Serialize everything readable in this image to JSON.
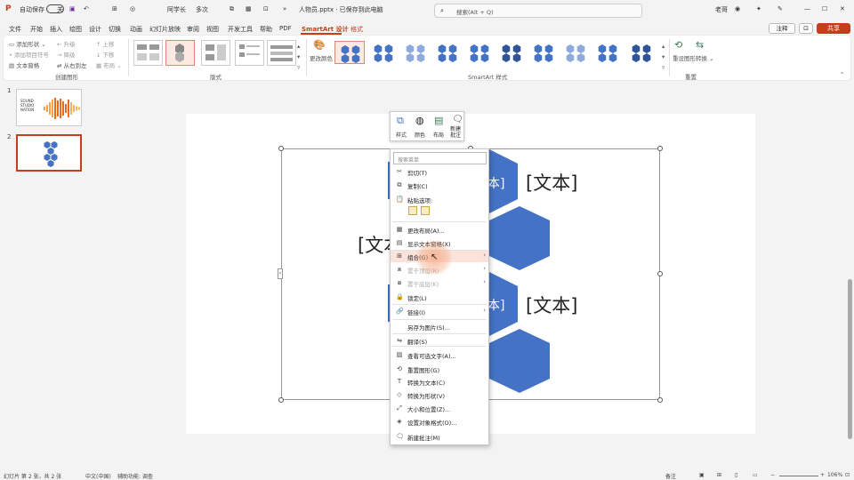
{
  "titlebar": {
    "autosave_label": "自动保存",
    "toggle_state": "关",
    "present_label": "阿学长",
    "draw_label": "多次",
    "filename": "人物员.pptx · 已保存到此电脑",
    "search_placeholder": "搜索(Alt + Q)",
    "user": "老哥"
  },
  "menu": {
    "tabs": [
      "文件",
      "开始",
      "插入",
      "绘图",
      "设计",
      "切换",
      "动画",
      "幻灯片放映",
      "审阅",
      "视图",
      "开发工具",
      "帮助",
      "PDF"
    ],
    "active_tab": "SmartArt 设计",
    "extra_tab": "格式",
    "comment_label": "注释",
    "share_label": "共享"
  },
  "ribbon": {
    "create": {
      "add_shape": "添加形状",
      "add_bullet": "添加项目符号",
      "text_pane": "文本窗格",
      "promote": "升级",
      "demote": "降级",
      "right_to_left": "从右到左",
      "move_up": "上移",
      "move_down": "下移",
      "layout": "布局",
      "group_label": "创建图形"
    },
    "layouts_group_label": "版式",
    "change_colors": "更改颜色",
    "styles_group_label": "SmartArt 样式",
    "reset_graphic": "重设图形",
    "convert": "转换",
    "reset_group_label": "重置"
  },
  "slides": [
    {
      "number": "1",
      "logo_text": "SOUND\nSTUDIO\nNATION"
    },
    {
      "number": "2"
    }
  ],
  "canvas": {
    "text_right_top": "[文本]",
    "text_right_bottom": "[文本]",
    "text_left": "[文本",
    "text_partial_top": "本]",
    "text_partial_bottom": "本]"
  },
  "mini_toolbar": {
    "style": "样式",
    "color": "颜色",
    "layout": "布局",
    "new_comment": "新建批注"
  },
  "context_menu": {
    "search_placeholder": "搜索菜单",
    "items": [
      {
        "label": "剪切(T)",
        "icon": "cut-icon",
        "disabled": false
      },
      {
        "label": "复制(C)",
        "icon": "copy-icon",
        "disabled": false
      },
      {
        "label": "粘贴选项:",
        "icon": "paste-icon",
        "disabled": false
      },
      {
        "label": "更改布局(A)...",
        "icon": "layout-icon",
        "disabled": false
      },
      {
        "label": "显示文本窗格(X)",
        "icon": "text-pane-icon",
        "disabled": false
      },
      {
        "label": "组合(G)",
        "icon": "group-icon",
        "disabled": false,
        "submenu": true,
        "hover": true
      },
      {
        "label": "置于顶层(R)",
        "icon": "bring-front-icon",
        "disabled": true,
        "submenu": true
      },
      {
        "label": "置于底层(K)",
        "icon": "send-back-icon",
        "disabled": true,
        "submenu": true
      },
      {
        "label": "锁定(L)",
        "icon": "lock-icon",
        "disabled": false
      },
      {
        "label": "链接(I)",
        "icon": "link-icon",
        "disabled": false,
        "submenu": true
      },
      {
        "label": "另存为图片(S)...",
        "icon": "",
        "disabled": false
      },
      {
        "label": "翻译(S)",
        "icon": "translate-icon",
        "disabled": false
      },
      {
        "label": "查看可选文字(A)...",
        "icon": "alt-text-icon",
        "disabled": false
      },
      {
        "label": "重置图形(G)",
        "icon": "reset-icon",
        "disabled": false
      },
      {
        "label": "转换为文本(C)",
        "icon": "convert-text-icon",
        "disabled": false
      },
      {
        "label": "转换为形状(V)",
        "icon": "convert-shape-icon",
        "disabled": false
      },
      {
        "label": "大小和位置(Z)...",
        "icon": "size-icon",
        "disabled": false
      },
      {
        "label": "设置对象格式(O)...",
        "icon": "format-icon",
        "disabled": false
      },
      {
        "label": "新建批注(M)",
        "icon": "comment-icon",
        "disabled": false
      }
    ]
  },
  "statusbar": {
    "slide_info": "幻灯片 第 2 张，共 2 张",
    "language": "中文(中国)",
    "accessibility": "辅助功能: 调查",
    "notes": "备注",
    "zoom": "106%"
  },
  "colors": {
    "accent": "#c43e1c",
    "hex_blue": "#4472c4"
  }
}
